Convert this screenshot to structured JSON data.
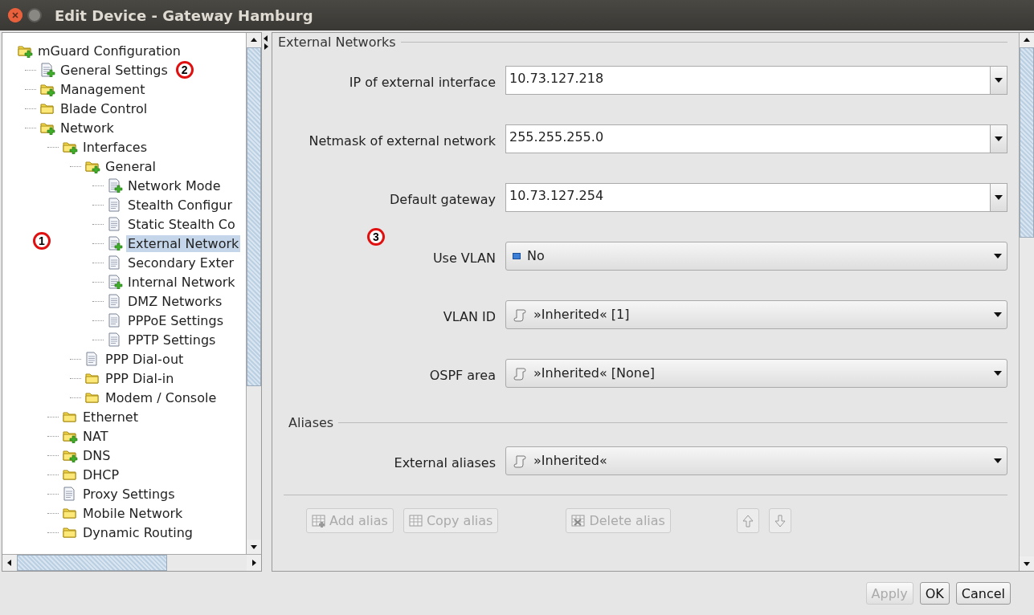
{
  "window": {
    "title": "Edit Device - Gateway Hamburg"
  },
  "tree": {
    "callout": "1",
    "items": [
      {
        "label": "mGuard Configuration",
        "kind": "folder-plus",
        "selected": false,
        "children": [
          {
            "label": "General Settings",
            "kind": "doc-plus",
            "selected": false,
            "callout": "2"
          },
          {
            "label": "Management",
            "kind": "folder-plus",
            "selected": false
          },
          {
            "label": "Blade Control",
            "kind": "folder",
            "selected": false
          },
          {
            "label": "Network",
            "kind": "folder-plus",
            "selected": false,
            "children": [
              {
                "label": "Interfaces",
                "kind": "folder-plus",
                "selected": false,
                "children": [
                  {
                    "label": "General",
                    "kind": "folder-plus",
                    "selected": false,
                    "children": [
                      {
                        "label": "Network Mode",
                        "kind": "doc-plus",
                        "selected": false
                      },
                      {
                        "label": "Stealth Configur",
                        "kind": "doc",
                        "selected": false
                      },
                      {
                        "label": "Static Stealth Co",
                        "kind": "doc",
                        "selected": false
                      },
                      {
                        "label": "External Network",
                        "kind": "doc-plus",
                        "selected": true
                      },
                      {
                        "label": "Secondary Exter",
                        "kind": "doc",
                        "selected": false
                      },
                      {
                        "label": "Internal Network",
                        "kind": "doc-plus",
                        "selected": false
                      },
                      {
                        "label": "DMZ Networks",
                        "kind": "doc",
                        "selected": false
                      },
                      {
                        "label": "PPPoE Settings",
                        "kind": "doc",
                        "selected": false
                      },
                      {
                        "label": "PPTP Settings",
                        "kind": "doc",
                        "selected": false
                      }
                    ]
                  },
                  {
                    "label": "PPP Dial-out",
                    "kind": "doc",
                    "selected": false
                  },
                  {
                    "label": "PPP Dial-in",
                    "kind": "folder",
                    "selected": false
                  },
                  {
                    "label": "Modem / Console",
                    "kind": "folder",
                    "selected": false
                  }
                ]
              },
              {
                "label": "Ethernet",
                "kind": "folder",
                "selected": false
              },
              {
                "label": "NAT",
                "kind": "folder-plus",
                "selected": false
              },
              {
                "label": "DNS",
                "kind": "folder-plus",
                "selected": false
              },
              {
                "label": "DHCP",
                "kind": "folder",
                "selected": false
              },
              {
                "label": "Proxy Settings",
                "kind": "doc",
                "selected": false
              },
              {
                "label": "Mobile Network",
                "kind": "folder",
                "selected": false
              },
              {
                "label": "Dynamic Routing",
                "kind": "folder",
                "selected": false
              }
            ]
          }
        ]
      }
    ]
  },
  "sections": [
    {
      "title": "External Networks",
      "rows": [
        {
          "label": "IP of external interface",
          "kind": "edit",
          "value": "10.73.127.218"
        },
        {
          "label": "Netmask of external network",
          "kind": "edit",
          "value": "255.255.255.0"
        },
        {
          "label": "Default gateway",
          "kind": "edit",
          "value": "10.73.127.254"
        },
        {
          "label": "Use VLAN",
          "kind": "flag-choice",
          "value": "No",
          "callout": "3"
        },
        {
          "label": "VLAN ID",
          "kind": "inherited-choice",
          "value": "»Inherited« [1]"
        },
        {
          "label": "OSPF area",
          "kind": "inherited-choice",
          "value": "»Inherited« [None]"
        }
      ]
    },
    {
      "title": "Aliases",
      "rows": [
        {
          "label": "External aliases",
          "kind": "inherited-choice",
          "value": "»Inherited«"
        }
      ]
    }
  ],
  "alias_buttons": [
    {
      "kind": "add",
      "label": "Add alias",
      "disabled": true
    },
    {
      "kind": "copy",
      "label": "Copy alias",
      "disabled": true
    },
    {
      "kind": "delete",
      "label": "Delete alias",
      "disabled": true
    },
    {
      "kind": "up",
      "disabled": true
    },
    {
      "kind": "down",
      "disabled": true
    }
  ],
  "buttons": [
    {
      "label": "Apply",
      "disabled": true
    },
    {
      "label": "OK",
      "disabled": false
    },
    {
      "label": "Cancel",
      "disabled": false
    }
  ]
}
